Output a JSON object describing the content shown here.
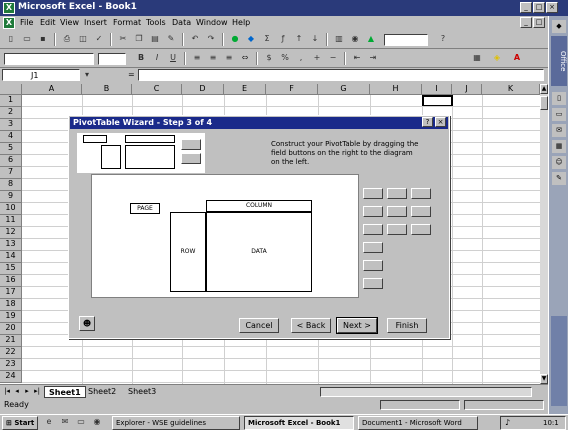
{
  "window": {
    "title": "Microsoft Excel - Book1",
    "app_icon": "excel-icon"
  },
  "menu": [
    "File",
    "Edit",
    "View",
    "Insert",
    "Format",
    "Tools",
    "Data",
    "Window",
    "Help"
  ],
  "formula_bar": {
    "name_box": "J1",
    "formula_symbol": "="
  },
  "columns": [
    "A",
    "B",
    "C",
    "D",
    "E",
    "F",
    "G",
    "H",
    "I",
    "J",
    "K"
  ],
  "rows": [
    "1",
    "2",
    "3",
    "4",
    "5",
    "6",
    "7",
    "8",
    "9",
    "10",
    "11",
    "12",
    "13",
    "14",
    "15",
    "16",
    "17",
    "18",
    "19",
    "20",
    "21",
    "22",
    "23",
    "24"
  ],
  "dialog": {
    "title": "PivotTable Wizard - Step 3 of 4",
    "description": "Construct your PivotTable by dragging the field buttons on the right to the diagram on the left.",
    "page_label": "PAGE",
    "column_label": "COLUMN",
    "row_label": "ROW",
    "data_label": "DATA",
    "buttons": {
      "cancel": "Cancel",
      "back": "< Back",
      "next": "Next >",
      "finish": "Finish"
    }
  },
  "sheets": [
    "Sheet1",
    "Sheet2",
    "Sheet3"
  ],
  "status": "Ready",
  "taskbar": {
    "start": "Start",
    "tasks": [
      "Explorer - WSE guidelines",
      "Microsoft Excel - Book1",
      "Document1 - Microsoft Word"
    ],
    "clock": "10:1"
  },
  "office_bar": {
    "label": "Office"
  }
}
